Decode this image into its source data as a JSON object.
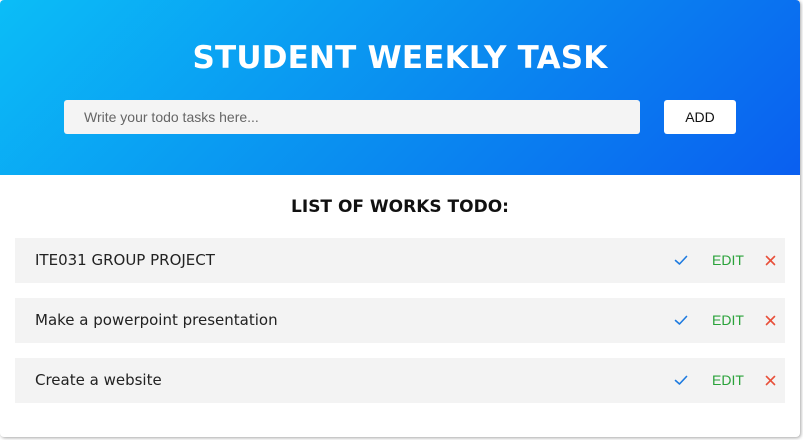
{
  "header": {
    "title": "STUDENT WEEKLY TASK",
    "input_placeholder": "Write your todo tasks here...",
    "input_value": "",
    "add_label": "ADD"
  },
  "list": {
    "title": "LIST OF WORKS TODO:",
    "edit_label": "EDIT",
    "tasks": [
      {
        "text": "ITE031 GROUP PROJECT"
      },
      {
        "text": "Make a powerpoint presentation"
      },
      {
        "text": "Create a website"
      }
    ]
  },
  "colors": {
    "gradient_start": "#0bbdf7",
    "gradient_end": "#0a5ff0",
    "check": "#1e7be0",
    "edit": "#2aa23a",
    "delete": "#e8503a"
  },
  "icons": {
    "complete": "check-icon",
    "delete": "close-icon"
  }
}
